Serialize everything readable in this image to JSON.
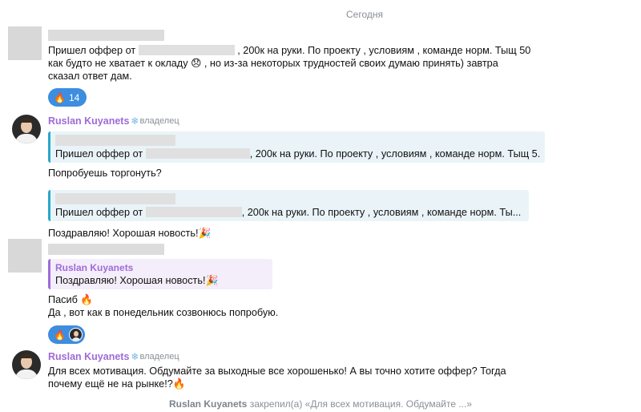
{
  "date_separator": "Сегодня",
  "messages": [
    {
      "text_before": "Пришел оффер от",
      "text_after": ", 200к на руки. По проекту , условиям , команде норм. Тыщ 50",
      "line2": "как будто не хватает к окладу 😞 , но из-за некоторых трудностей своих думаю принять) завтра",
      "line3": "сказал ответ дам.",
      "reaction": {
        "emoji": "🔥",
        "count": "14"
      }
    },
    {
      "sender": "Ruslan Kuyanets",
      "role_icon": "❄",
      "role": "владелец",
      "quote1_before": "Пришел оффер от",
      "quote1_after": ", 200к на руки. По проекту , условиям , команде норм. Тыщ 5...",
      "text1": "Попробуешь торгонуть?",
      "quote2_before": "Пришел оффер от",
      "quote2_after": ", 200к на руки. По проекту , условиям , команде норм. Ты...",
      "text2": "Поздравляю! Хорошая новость!🎉"
    },
    {
      "quote_sender": "Ruslan Kuyanets",
      "quote_text": "Поздравляю! Хорошая новость!🎉",
      "line1": "Пасиб 🔥",
      "line2": "Да , вот как в понедельник созвонюсь попробую.",
      "reaction": {
        "emoji": "🔥"
      }
    },
    {
      "sender": "Ruslan Kuyanets",
      "role_icon": "❄",
      "role": "владелец",
      "line1": "Для всех мотивация. Обдумайте за выходные все хорошенько! А вы точно хотите оффер? Тогда",
      "line2": "почему ещё не на рынке!?🔥"
    }
  ],
  "service": {
    "name": "Ruslan Kuyanets",
    "text": "закрепил(а) «Для всех мотивация. Обдумайте ...»"
  }
}
